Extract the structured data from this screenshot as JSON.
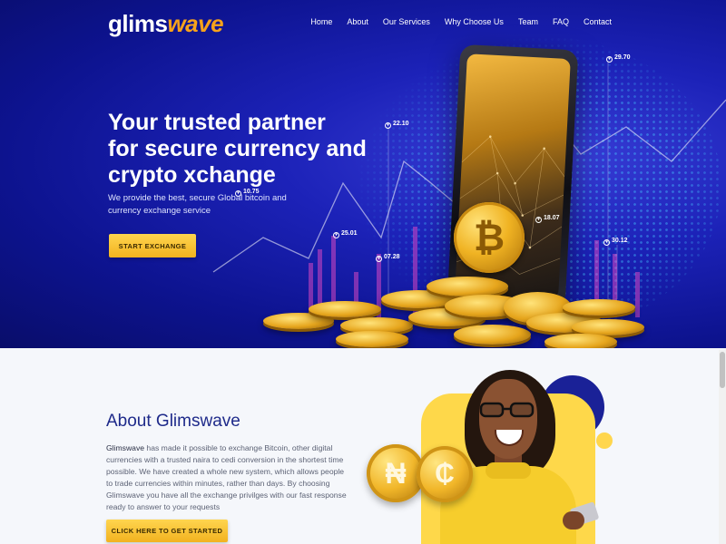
{
  "brand": {
    "part1": "glims",
    "part2": "wave"
  },
  "nav": {
    "items": [
      "Home",
      "About",
      "Our Services",
      "Why Choose Us",
      "Team",
      "FAQ",
      "Contact"
    ]
  },
  "hero": {
    "title_line1": "Your trusted partner",
    "title_line2": "for secure currency and",
    "title_line3": "crypto xchange",
    "subtitle": "We provide the best, secure Global bitcoin and currency exchange service",
    "cta": "START EXCHANGE",
    "tags": [
      "29.70",
      "22.10",
      "10.75",
      "18.07",
      "25.01",
      "30.12",
      "07.28"
    ]
  },
  "about": {
    "title": "About Glimswave",
    "brand_name": "Glimswave",
    "text": " has made it possible to exchange Bitcoin, other digital currencies with a trusted naira to cedi conversion in the shortest time possible. We have created a whole new system, which allows people to trade currencies within minutes, rather than days. By choosing Glimswave you have all the exchange privilges with our fast response ready to answer to your requests",
    "cta": "CLICK HERE TO GET STARTED"
  },
  "coin_symbols": {
    "bitcoin": "₿",
    "naira": "₦",
    "cedi": "₵"
  },
  "colors": {
    "hero_bg": "#1c22b8",
    "accent_yellow": "#f7c12a",
    "brand_orange": "#f7a21b",
    "title_navy": "#1e2a8a"
  }
}
